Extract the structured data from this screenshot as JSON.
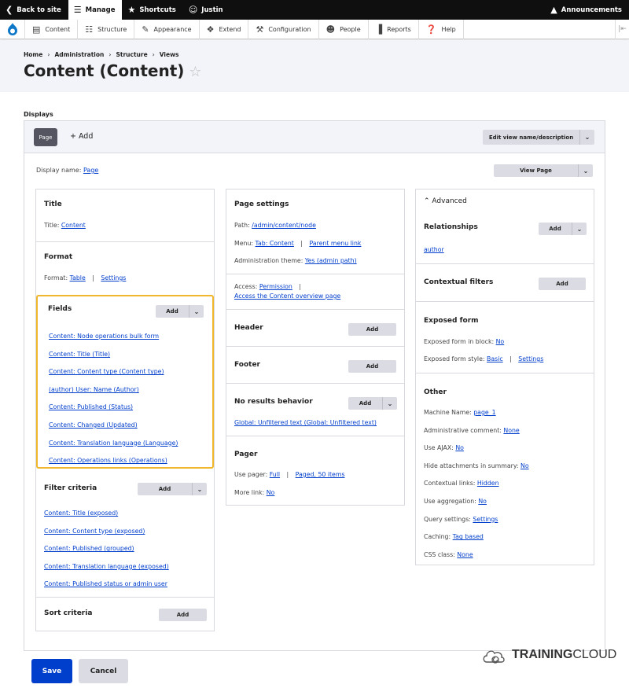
{
  "toolbar": {
    "back_label": "Back to site",
    "manage_label": "Manage",
    "shortcuts_label": "Shortcuts",
    "user_label": "Justin",
    "announcements_label": "Announcements"
  },
  "admin_menu": {
    "items": [
      "Content",
      "Structure",
      "Appearance",
      "Extend",
      "Configuration",
      "People",
      "Reports",
      "Help"
    ]
  },
  "breadcrumb": [
    "Home",
    "Administration",
    "Structure",
    "Views"
  ],
  "page_title": "Content (Content)",
  "displays_label": "Displays",
  "display_tabs": {
    "page_tab": "Page",
    "add_label": "+ Add",
    "edit_name_button": "Edit view name/description",
    "view_page_button": "View Page"
  },
  "display_name": {
    "label": "Display name:",
    "value": "Page"
  },
  "col1": {
    "title": {
      "heading": "Title",
      "label": "Title:",
      "value": "Content"
    },
    "format": {
      "heading": "Format",
      "label": "Format:",
      "value": "Table",
      "settings": "Settings"
    },
    "fields": {
      "heading": "Fields",
      "add": "Add",
      "items": [
        "Content: Node operations bulk form",
        "Content: Title (Title)",
        "Content: Content type (Content type)",
        "(author) User: Name (Author)",
        "Content: Published (Status)",
        "Content: Changed (Updated)",
        "Content: Translation language (Language)",
        "Content: Operations links (Operations)"
      ]
    },
    "filter": {
      "heading": "Filter criteria",
      "add": "Add",
      "items": [
        "Content: Title (exposed)",
        "Content: Content type (exposed)",
        "Content: Published (grouped)",
        "Content: Translation language (exposed)",
        "Content: Published status or admin user"
      ]
    },
    "sort": {
      "heading": "Sort criteria",
      "add": "Add"
    }
  },
  "col2": {
    "page_settings": {
      "heading": "Page settings",
      "path_label": "Path:",
      "path_value": "/admin/content/node",
      "menu_label": "Menu:",
      "menu_value": "Tab: Content",
      "menu_parent": "Parent menu link",
      "theme_label": "Administration theme:",
      "theme_value": "Yes (admin path)"
    },
    "access": {
      "label": "Access:",
      "value": "Permission",
      "link2": "Access the Content overview page"
    },
    "header": {
      "heading": "Header",
      "add": "Add"
    },
    "footer": {
      "heading": "Footer",
      "add": "Add"
    },
    "no_results": {
      "heading": "No results behavior",
      "add": "Add",
      "item": "Global: Unfiltered text (Global: Unfiltered text)"
    },
    "pager": {
      "heading": "Pager",
      "use_label": "Use pager:",
      "use_full": "Full",
      "use_paged": "Paged, 50 items",
      "more_label": "More link:",
      "more_value": "No"
    }
  },
  "col3": {
    "advanced_label": "Advanced",
    "relationships": {
      "heading": "Relationships",
      "add": "Add",
      "item": "author"
    },
    "contextual": {
      "heading": "Contextual filters",
      "add": "Add"
    },
    "exposed": {
      "heading": "Exposed form",
      "block_label": "Exposed form in block:",
      "block_value": "No",
      "style_label": "Exposed form style:",
      "style_value": "Basic",
      "style_settings": "Settings"
    },
    "other": {
      "heading": "Other",
      "rows": [
        {
          "label": "Machine Name:",
          "value": "page_1"
        },
        {
          "label": "Administrative comment:",
          "value": "None"
        },
        {
          "label": "Use AJAX:",
          "value": "No"
        },
        {
          "label": "Hide attachments in summary:",
          "value": "No"
        },
        {
          "label": "Contextual links:",
          "value": "Hidden"
        },
        {
          "label": "Use aggregation:",
          "value": "No"
        },
        {
          "label": "Query settings:",
          "value": "Settings"
        },
        {
          "label": "Caching:",
          "value": "Tag based"
        },
        {
          "label": "CSS class:",
          "value": "None"
        }
      ]
    }
  },
  "actions": {
    "save": "Save",
    "cancel": "Cancel"
  },
  "brand": {
    "part1": "TRAINING",
    "part2": "CLOUD"
  },
  "colors": {
    "accent": "#003ecc",
    "highlight": "#f0b72c",
    "toolbar": "#0f0f0f"
  }
}
